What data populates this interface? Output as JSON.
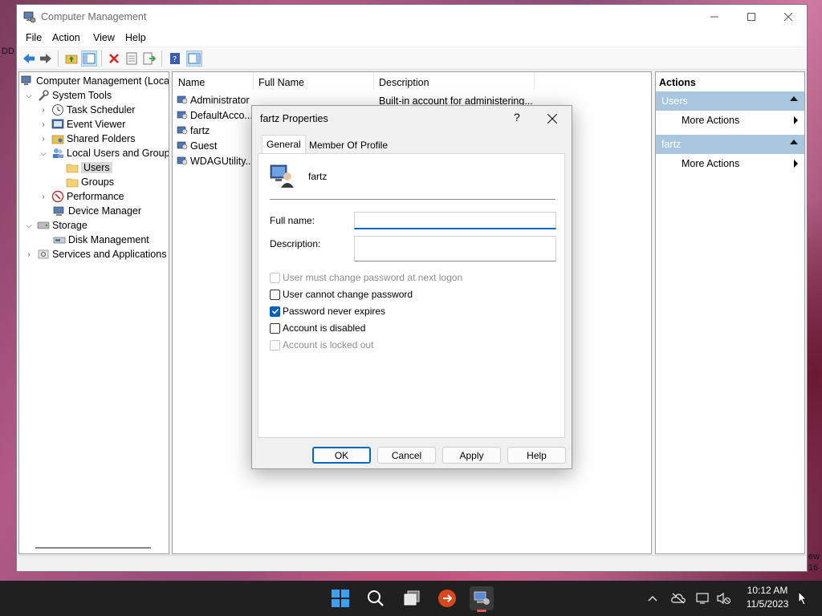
{
  "window": {
    "title": "Computer Management"
  },
  "menu": [
    "File",
    "Action",
    "View",
    "Help"
  ],
  "tree": {
    "root": "Computer Management (Local",
    "system_tools": "System Tools",
    "task_scheduler": "Task Scheduler",
    "event_viewer": "Event Viewer",
    "shared_folders": "Shared Folders",
    "local_users_groups": "Local Users and Groups",
    "users": "Users",
    "groups": "Groups",
    "performance": "Performance",
    "device_manager": "Device Manager",
    "storage": "Storage",
    "disk_management": "Disk Management",
    "services_apps": "Services and Applications"
  },
  "list": {
    "columns": [
      "Name",
      "Full Name",
      "Description"
    ],
    "rows": [
      {
        "name": "Administrator",
        "description": "Built-in account for administering..."
      },
      {
        "name": "DefaultAcco...",
        "description": ""
      },
      {
        "name": "fartz",
        "description": ""
      },
      {
        "name": "Guest",
        "description": ""
      },
      {
        "name": "WDAGUtility...",
        "description": ""
      }
    ]
  },
  "actions": {
    "header": "Actions",
    "group1": "Users",
    "group1_item": "More Actions",
    "group2": "fartz",
    "group2_item": "More Actions"
  },
  "dialog": {
    "title": "fartz Properties",
    "help_glyph": "?",
    "tabs": [
      "General",
      "Member Of",
      "Profile"
    ],
    "username": "fartz",
    "full_name_label": "Full name:",
    "full_name_value": "",
    "description_label": "Description:",
    "description_value": "",
    "checkboxes": [
      {
        "label": "User must change password at next logon",
        "checked": false,
        "enabled": false
      },
      {
        "label": "User cannot change password",
        "checked": false,
        "enabled": true
      },
      {
        "label": "Password never expires",
        "checked": true,
        "enabled": true
      },
      {
        "label": "Account is disabled",
        "checked": false,
        "enabled": true
      },
      {
        "label": "Account is locked out",
        "checked": false,
        "enabled": false
      }
    ],
    "buttons": {
      "ok": "OK",
      "cancel": "Cancel",
      "apply": "Apply",
      "help": "Help"
    }
  },
  "taskbar": {
    "time": "10:12 AM",
    "date": "11/5/2023"
  },
  "wallpaper_fragments": {
    "left_top": "DD",
    "right_a": "ew",
    "right_b": "16"
  },
  "colors": {
    "accent": "#0067c0",
    "actions_group": "#a9c6df",
    "taskbar": "#202020"
  }
}
